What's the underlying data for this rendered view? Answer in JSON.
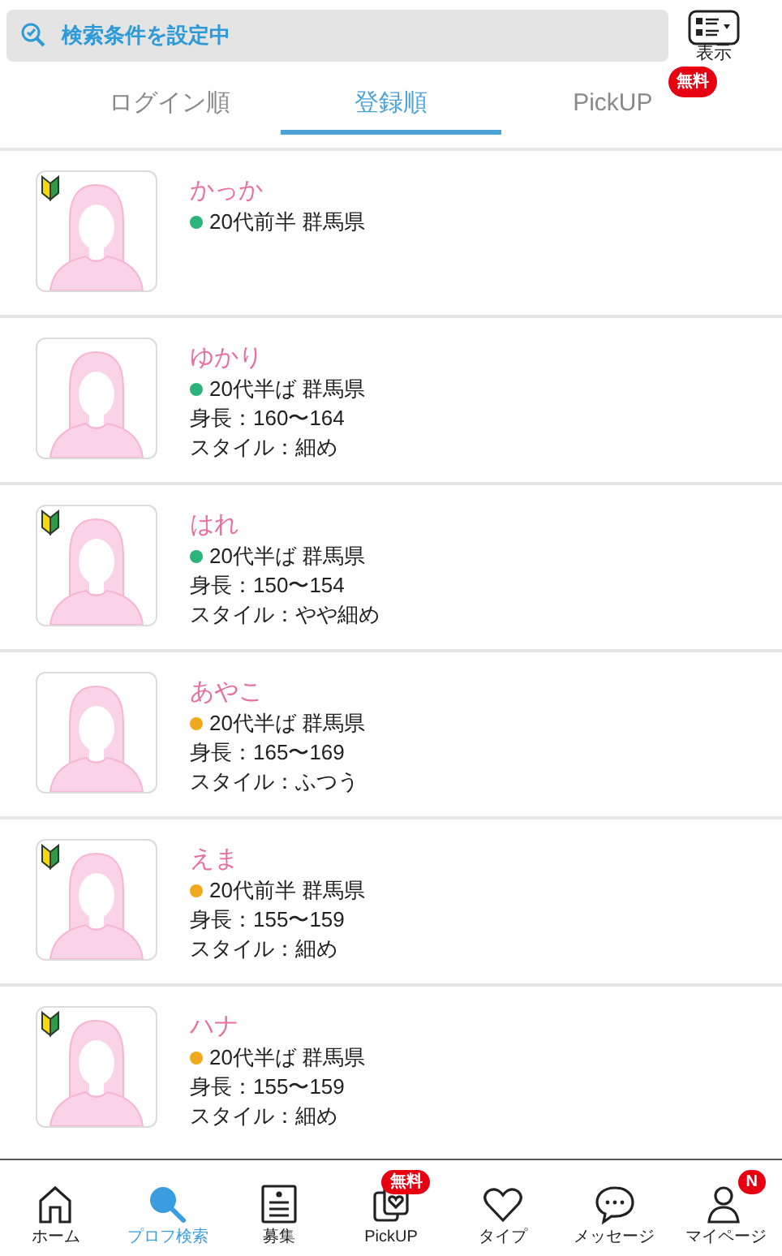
{
  "search_bar": {
    "label": "検索条件を設定中"
  },
  "display_button": {
    "label": "表示"
  },
  "tabs": [
    {
      "label": "ログイン順",
      "selected": false
    },
    {
      "label": "登録順",
      "selected": true
    },
    {
      "label": "PickUP",
      "selected": false,
      "badge": "無料"
    }
  ],
  "profiles": [
    {
      "name": "かっか",
      "beginner": true,
      "color": "#2bb37a",
      "summary": "20代前半 群馬県"
    },
    {
      "name": "ゆかり",
      "beginner": false,
      "color": "#2bb37a",
      "summary": "20代半ば 群馬県",
      "height": "身長：160〜164",
      "style": "スタイル：細め"
    },
    {
      "name": "はれ",
      "beginner": true,
      "color": "#2bb37a",
      "summary": "20代半ば 群馬県",
      "height": "身長：150〜154",
      "style": "スタイル：やや細め"
    },
    {
      "name": "あやこ",
      "beginner": false,
      "color": "#f0a81c",
      "summary": "20代半ば 群馬県",
      "height": "身長：165〜169",
      "style": "スタイル：ふつう"
    },
    {
      "name": "えま",
      "beginner": true,
      "color": "#f0a81c",
      "summary": "20代前半 群馬県",
      "height": "身長：155〜159",
      "style": "スタイル：細め"
    },
    {
      "name": "ハナ",
      "beginner": true,
      "color": "#f0a81c",
      "summary": "20代半ば 群馬県",
      "height": "身長：155〜159",
      "style": "スタイル：細め"
    }
  ],
  "bottom_nav": [
    {
      "kind": "home",
      "label": "ホーム",
      "selected": false
    },
    {
      "kind": "search",
      "label": "プロフ検索",
      "selected": true
    },
    {
      "kind": "board",
      "label": "募集",
      "selected": false
    },
    {
      "kind": "pickup",
      "label": "PickUP",
      "selected": false,
      "badge": "無料"
    },
    {
      "kind": "heart",
      "label": "タイプ",
      "selected": false
    },
    {
      "kind": "chat",
      "label": "メッセージ",
      "selected": false
    },
    {
      "kind": "person",
      "label": "マイページ",
      "selected": false,
      "badge": "N"
    }
  ]
}
